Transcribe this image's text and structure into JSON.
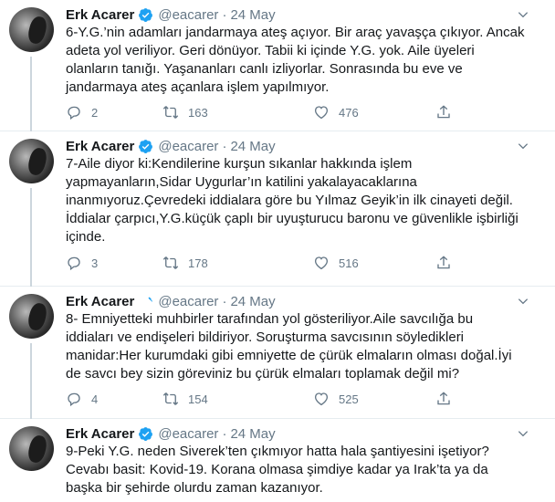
{
  "tweets": [
    {
      "name": "Erk Acarer",
      "handle": "@eacarer",
      "separator": "·",
      "date": "24 May",
      "lines": [
        "6-Y.G.’nin adamları jandarmaya ateş açıyor. Bir araç yavaşça çıkıyor. Ancak",
        "adeta yol veriliyor. Geri dönüyor. Tabii ki içinde Y.G. yok. Aile üyeleri",
        "olanların tanığı. Yaşananları canlı izliyorlar. Sonrasında bu eve ve",
        "jandarmaya ateş açanlara işlem yapılmıyor."
      ],
      "replies": "2",
      "retweets": "163",
      "likes": "476"
    },
    {
      "name": "Erk Acarer",
      "handle": "@eacarer",
      "separator": "·",
      "date": "24 May",
      "lines": [
        "7-Aile diyor ki:Kendilerine kurşun sıkanlar hakkında işlem",
        "yapmayanların,Sidar Uygurlar’ın katilini yakalayacaklarına",
        "inanmıyoruz.Çevredeki iddialara göre bu Yılmaz Geyik’in ilk cinayeti değil.",
        "İddialar çarpıcı,Y.G.küçük çaplı bir uyuşturucu baronu ve güvenlikle işbirliği",
        "içinde."
      ],
      "replies": "3",
      "retweets": "178",
      "likes": "516"
    },
    {
      "name": "Erk Acarer",
      "handle": "@eacarer",
      "separator": "·",
      "date": "24 May",
      "lines": [
        "8- Emniyetteki muhbirler tarafından yol gösteriliyor.Aile savcılığa bu",
        "iddiaları ve endişeleri bildiriyor. Soruşturma savcısının söyledikleri",
        "manidar:Her kurumdaki gibi emniyette de çürük elmaların olması doğal.İyi",
        "de savcı bey sizin göreviniz bu çürük elmaları toplamak değil mi?"
      ],
      "replies": "4",
      "retweets": "154",
      "likes": "525"
    },
    {
      "name": "Erk Acarer",
      "handle": "@eacarer",
      "separator": "·",
      "date": "24 May",
      "lines": [
        "9-Peki Y.G. neden Siverek’ten çıkmıyor hatta hala şantiyesini işetiyor?",
        "Cevabı basit: Kovid-19. Korana olmasa şimdiye kadar ya Irak’ta ya da",
        "başka bir şehirde olurdu zaman kazanıyor."
      ]
    }
  ],
  "icons": {
    "verified": "verified-badge-icon",
    "caret": "chevron-down-icon",
    "reply": "reply-icon",
    "retweet": "retweet-icon",
    "like": "heart-icon",
    "share": "share-icon"
  },
  "colors": {
    "accent": "#1da1f2",
    "text": "#14171a",
    "secondary": "#657786",
    "divider": "#e6ecf0"
  }
}
